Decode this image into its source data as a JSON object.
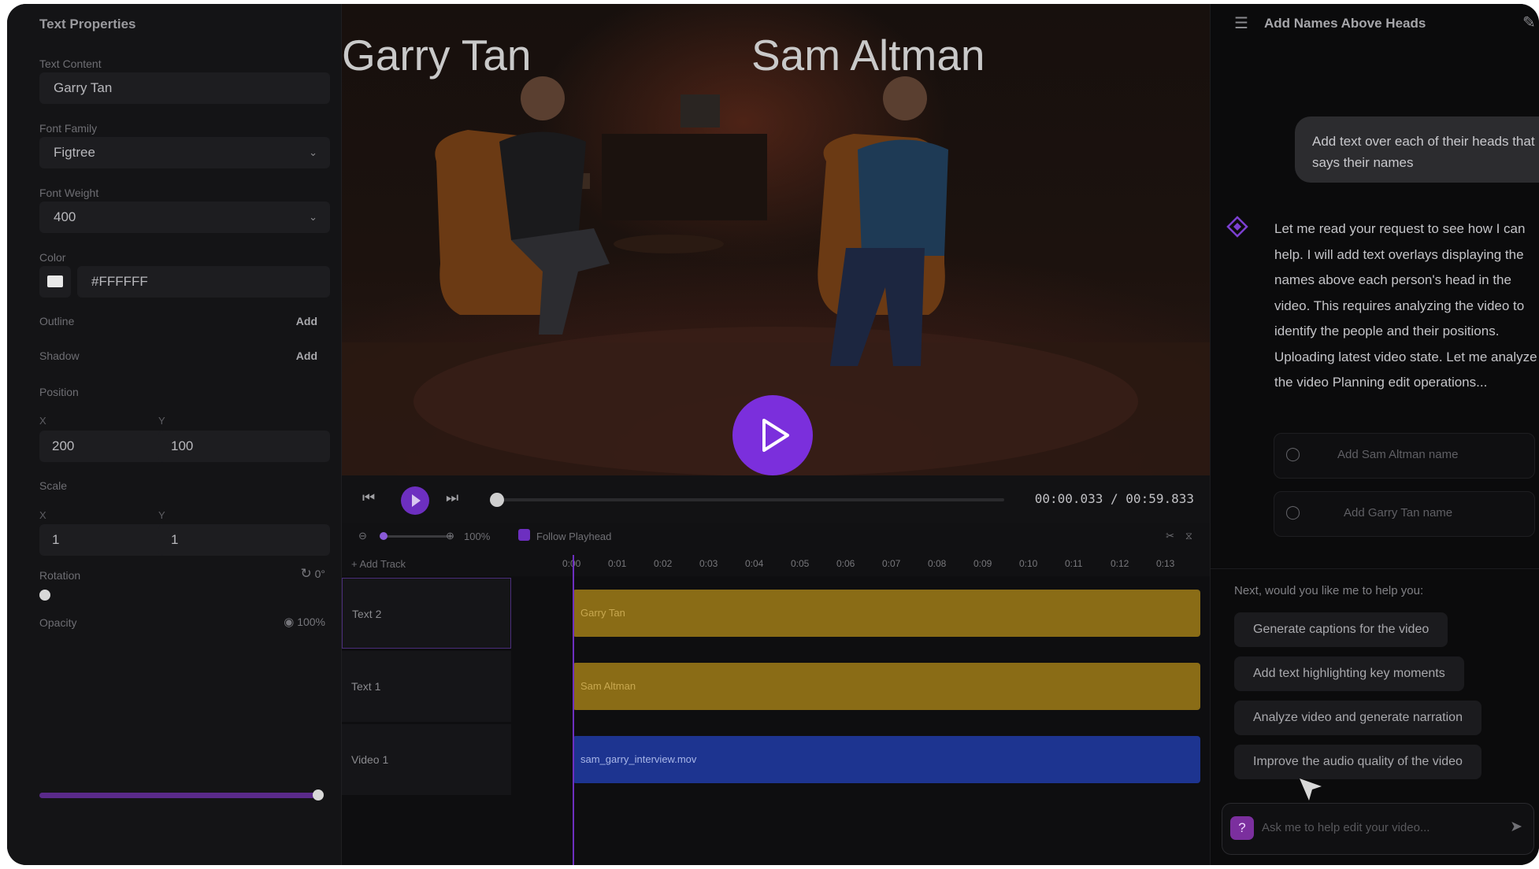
{
  "properties": {
    "title": "Text Properties",
    "text_content_label": "Text Content",
    "text_content_value": "Garry Tan",
    "font_family_label": "Font Family",
    "font_family_value": "Figtree",
    "font_weight_label": "Font Weight",
    "font_weight_value": "400",
    "color_label": "Color",
    "color_value": "#FFFFFF",
    "outline_label": "Outline",
    "outline_add": "Add",
    "shadow_label": "Shadow",
    "shadow_add": "Add",
    "position_label": "Position",
    "position_x_label": "X",
    "position_y_label": "Y",
    "position_x": "200",
    "position_y": "100",
    "scale_label": "Scale",
    "scale_x_label": "X",
    "scale_y_label": "Y",
    "scale_x": "1",
    "scale_y": "1",
    "rotation_label": "Rotation",
    "rotation_value": "0°",
    "opacity_label": "Opacity",
    "opacity_value": "100%",
    "opacity_level": 1.0
  },
  "video": {
    "overlay_left": "Garry Tan",
    "overlay_right": "Sam Altman",
    "timecode": "00:00.033 / 00:59.833"
  },
  "timeline": {
    "zoom_value": "100%",
    "follow_playhead": "Follow Playhead",
    "add_track": "+ Add Track",
    "ticks": [
      "0:00",
      "0:01",
      "0:02",
      "0:03",
      "0:04",
      "0:05",
      "0:06",
      "0:07",
      "0:08",
      "0:09",
      "0:10",
      "0:11",
      "0:12",
      "0:13"
    ],
    "tracks": [
      {
        "label": "Text 2",
        "clip": "Garry Tan"
      },
      {
        "label": "Text 1",
        "clip": "Sam Altman"
      },
      {
        "label": "Video 1",
        "clip": "sam_garry_interview.mov"
      }
    ]
  },
  "chat": {
    "title": "Add Names Above Heads",
    "user_message": "Add text over each of their heads that says their names",
    "assistant_message": "Let me read your request to see how I can help. I will add text overlays displaying the names above each person's head in the video. This requires analyzing the video to identify the people and their positions. Uploading latest video state. Let me analyze the video Planning edit operations...",
    "tasks": [
      "Add Sam Altman name",
      "Add Garry Tan name"
    ],
    "next_label": "Next, would you like me to help you:",
    "suggestions": [
      "Generate captions for the video",
      "Add text highlighting key moments",
      "Analyze video and generate narration",
      "Improve the audio quality of the video"
    ],
    "input_placeholder": "Ask me to help edit your video..."
  },
  "colors": {
    "accent": "#7b2fdc",
    "text_clip": "#9a7a1e",
    "video_clip": "#1f3c9e"
  }
}
